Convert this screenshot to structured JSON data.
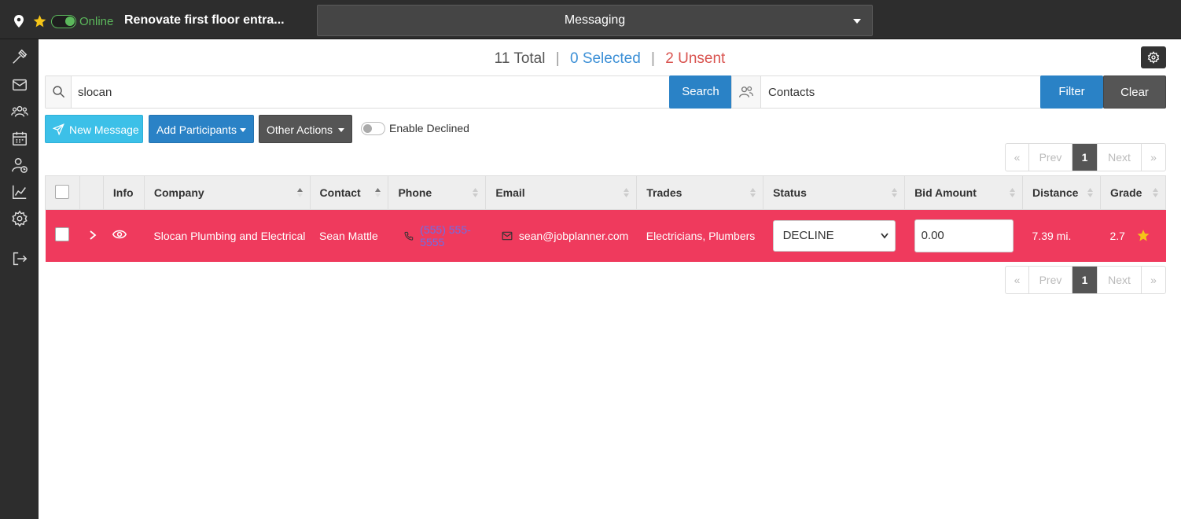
{
  "topbar": {
    "online_label": "Online",
    "project_title": "Renovate first floor entra...",
    "mode": "Messaging"
  },
  "sidebar": {
    "items": [
      "hammer-icon",
      "mail-icon",
      "users-icon",
      "calendar-icon",
      "user-clock-icon",
      "chart-icon",
      "gear-icon",
      "logout-icon"
    ]
  },
  "counts": {
    "total": "11 Total",
    "selected": "0 Selected",
    "unsent": "2 Unsent",
    "separator": "|"
  },
  "search": {
    "value": "slocan",
    "button": "Search"
  },
  "filter": {
    "group": "Contacts",
    "filter_button": "Filter",
    "clear_button": "Clear"
  },
  "actions": {
    "new_message": "New Message",
    "add_participants": "Add Participants",
    "other_actions": "Other Actions",
    "enable_declined": "Enable Declined"
  },
  "pager": {
    "first": "«",
    "prev": "Prev",
    "page": "1",
    "next": "Next",
    "last": "»"
  },
  "table": {
    "headers": {
      "info": "Info",
      "company": "Company",
      "contact": "Contact",
      "phone": "Phone",
      "email": "Email",
      "trades": "Trades",
      "status": "Status",
      "bid_amount": "Bid Amount",
      "distance": "Distance",
      "grade": "Grade"
    },
    "rows": [
      {
        "company": "Slocan Plumbing and Electrical",
        "contact": "Sean Mattle",
        "phone": "(555) 555-5555",
        "email": "sean@jobplanner.com",
        "trades": "Electricians, Plumbers",
        "status": "DECLINE",
        "bid_amount": "0.00",
        "distance": "7.39 mi.",
        "grade": "2.7"
      }
    ]
  },
  "colors": {
    "row_highlight": "#ef3a5d",
    "primary": "#2a82c6",
    "info": "#3cc0e8",
    "online": "#5cb85c"
  }
}
